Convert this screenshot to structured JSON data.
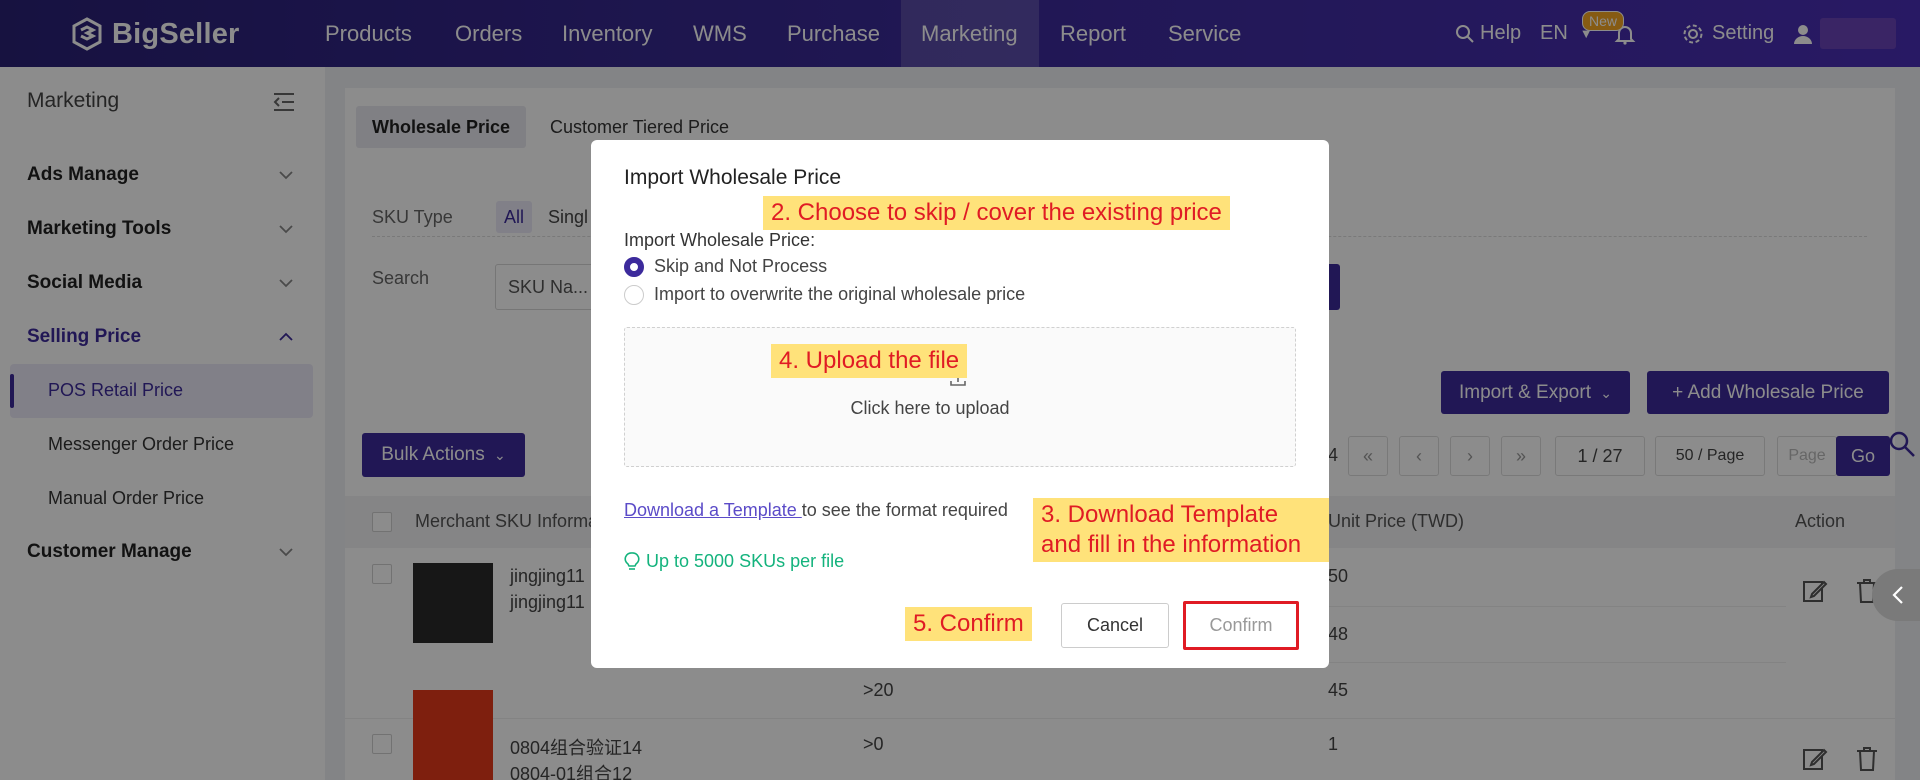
{
  "brand": {
    "name": "BigSeller"
  },
  "topnav": {
    "items": [
      "Products",
      "Orders",
      "Inventory",
      "WMS",
      "Purchase",
      "Marketing",
      "Report",
      "Service"
    ],
    "active": "Marketing",
    "help": "Help",
    "language": "EN",
    "badge": "New",
    "setting": "Setting"
  },
  "sidebar": {
    "title": "Marketing",
    "groups": {
      "ads": "Ads Manage",
      "tools": "Marketing Tools",
      "social": "Social Media",
      "selling": "Selling Price",
      "customer": "Customer Manage"
    },
    "selling_items": [
      "POS Retail Price",
      "Messenger Order Price",
      "Manual Order Price"
    ]
  },
  "main": {
    "tabs": [
      "Wholesale Price",
      "Customer Tiered Price"
    ],
    "sku_type_label": "SKU Type",
    "sku_type_options": [
      "All",
      "Singl"
    ],
    "search_label": "Search",
    "search_value": "SKU Na...",
    "import_export": "Import & Export",
    "add_wholesale": "+ Add Wholesale Price",
    "bulk_actions": "Bulk Actions",
    "pager": {
      "total_fragment": "4",
      "page": "1 / 27",
      "page_size": "50 / Page",
      "page_placeholder": "Page",
      "go": "Go"
    },
    "table": {
      "headers": [
        "Merchant SKU Informa",
        "Unit Price (TWD)",
        "Action"
      ],
      "rows": [
        {
          "sku1": "jingjing11",
          "sku2": "jingjing11",
          "qty": [
            ">20"
          ],
          "prices": [
            "50",
            "48",
            "45"
          ]
        },
        {
          "sku1": "0804组合验证14",
          "sku2": "0804-01组合12",
          "qty": [
            ">0"
          ],
          "prices": [
            "1"
          ]
        }
      ]
    }
  },
  "modal": {
    "title": "Import Wholesale Price",
    "radio_group_label": "Import Wholesale Price:",
    "options": [
      "Skip and Not Process",
      "Import to overwrite the original wholesale price"
    ],
    "selected_option": "Skip and Not Process",
    "upload_text": "Click here to upload",
    "template_link": "Download a Template ",
    "template_suffix": "to see the format required",
    "hint": "Up to 5000 SKUs per file",
    "cancel": "Cancel",
    "confirm": "Confirm"
  },
  "annotations": {
    "step2": "2. Choose to skip / cover the existing price",
    "step3_line1": "3. Download Template",
    "step3_line2": "and fill in the information",
    "step4": "4. Upload the file",
    "step5": "5. Confirm"
  },
  "colors": {
    "brand_purple": "#3c2a9c",
    "nav_gradient_start": "#2a2176",
    "nav_gradient_end": "#4a2fb6",
    "annotation_bg": "#ffe27a",
    "annotation_text": "#e01b24",
    "hint_green": "#14b37d"
  }
}
